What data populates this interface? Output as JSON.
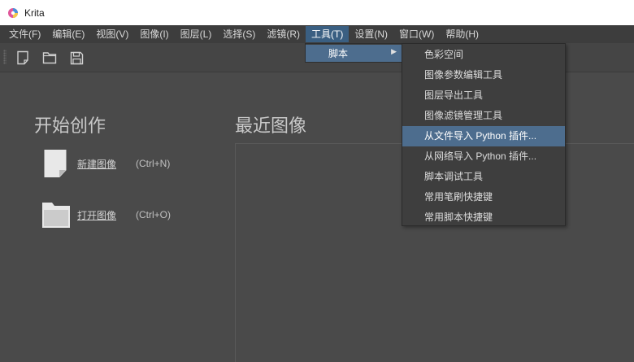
{
  "window": {
    "title": "Krita",
    "app_icon": "krita-logo-icon"
  },
  "menubar": {
    "items": [
      {
        "label": "文件(F)"
      },
      {
        "label": "编辑(E)"
      },
      {
        "label": "视图(V)"
      },
      {
        "label": "图像(I)"
      },
      {
        "label": "图层(L)"
      },
      {
        "label": "选择(S)"
      },
      {
        "label": "滤镜(R)"
      },
      {
        "label": "工具(T)",
        "active": true
      },
      {
        "label": "设置(N)"
      },
      {
        "label": "窗口(W)"
      },
      {
        "label": "帮助(H)"
      }
    ]
  },
  "toolbar": {
    "buttons": [
      {
        "name": "new-document-icon"
      },
      {
        "name": "open-folder-icon"
      },
      {
        "name": "save-disk-icon"
      }
    ]
  },
  "welcome": {
    "start_heading": "开始创作",
    "recent_heading": "最近图像",
    "new_image": {
      "label": "新建图像",
      "shortcut": "(Ctrl+N)"
    },
    "open_image": {
      "label": "打开图像",
      "shortcut": "(Ctrl+O)"
    }
  },
  "tools_menu": {
    "scripts_label": "脚本",
    "scripts_items": [
      {
        "label": "色彩空间"
      },
      {
        "label": "图像参数编辑工具"
      },
      {
        "label": "图层导出工具"
      },
      {
        "label": "图像滤镜管理工具"
      },
      {
        "label": "从文件导入 Python 插件...",
        "highlighted": true
      },
      {
        "label": "从网络导入 Python 插件..."
      },
      {
        "label": "脚本调试工具"
      },
      {
        "label": "常用笔刷快捷键"
      },
      {
        "label": "常用脚本快捷键"
      }
    ]
  },
  "colors": {
    "background": "#4a4a4a",
    "menubar": "#3d3d3d",
    "highlight": "#4d6d8e",
    "active_menu": "#3a5f82"
  }
}
